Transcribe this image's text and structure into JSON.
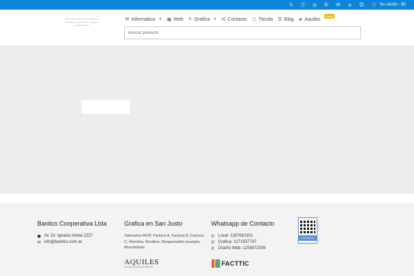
{
  "topbar": {
    "icons": [
      "twitter-icon",
      "facebook-icon",
      "instagram-icon",
      "phone-icon",
      "email-icon",
      "home-icon",
      "user-icon"
    ],
    "cart_label": "Su carrito - $0"
  },
  "logo": {
    "lines": [
      "NUEVOS OBST NUEVAS TECNOLOGIAS DE LA",
      "INFORMACION, COMUNICACION Y SISTEMAS",
      "COOPERATIVA LTDA"
    ]
  },
  "nav": {
    "items": [
      {
        "label": "Informática",
        "icon": "wrench-icon",
        "dropdown": true
      },
      {
        "label": "Web",
        "icon": "web-icon",
        "dropdown": false
      },
      {
        "label": "Grafica",
        "icon": "brush-icon",
        "dropdown": true
      },
      {
        "label": "Contacto",
        "icon": "envelope-icon",
        "dropdown": false
      },
      {
        "label": "Tienda",
        "icon": "store-icon",
        "dropdown": false
      },
      {
        "label": "Blog",
        "icon": "blog-icon",
        "dropdown": false
      },
      {
        "label": "Aquiles",
        "icon": "tag-icon",
        "dropdown": false,
        "badge": "Nuevo"
      }
    ]
  },
  "search": {
    "placeholder": "Buscar producto"
  },
  "footer": {
    "col1": {
      "title": "Bantics Cooperativa Ltda",
      "address": "Av. Dr. Ignacio Arieta 2227",
      "email": "info@bantics.com.ar"
    },
    "col2": {
      "title": "Grafica en San Justo",
      "text": "Talonarios AFIP, Factura A, Factura B, Factura C, Remitos, Recibos, Responsable inscripto, Monotributo."
    },
    "col3": {
      "title": "Whatsapp de Contacto",
      "lines": [
        "Local: 1167610101",
        "Grafica: 1171537747",
        "Diseño Web: 1155972036"
      ]
    },
    "qr_label": "DATA FISCAL",
    "aquiles_brand": "AQUILES",
    "aquiles_sub": "FACTURACION ELECTRONICA",
    "facttic_brand": "FACTTIC"
  }
}
